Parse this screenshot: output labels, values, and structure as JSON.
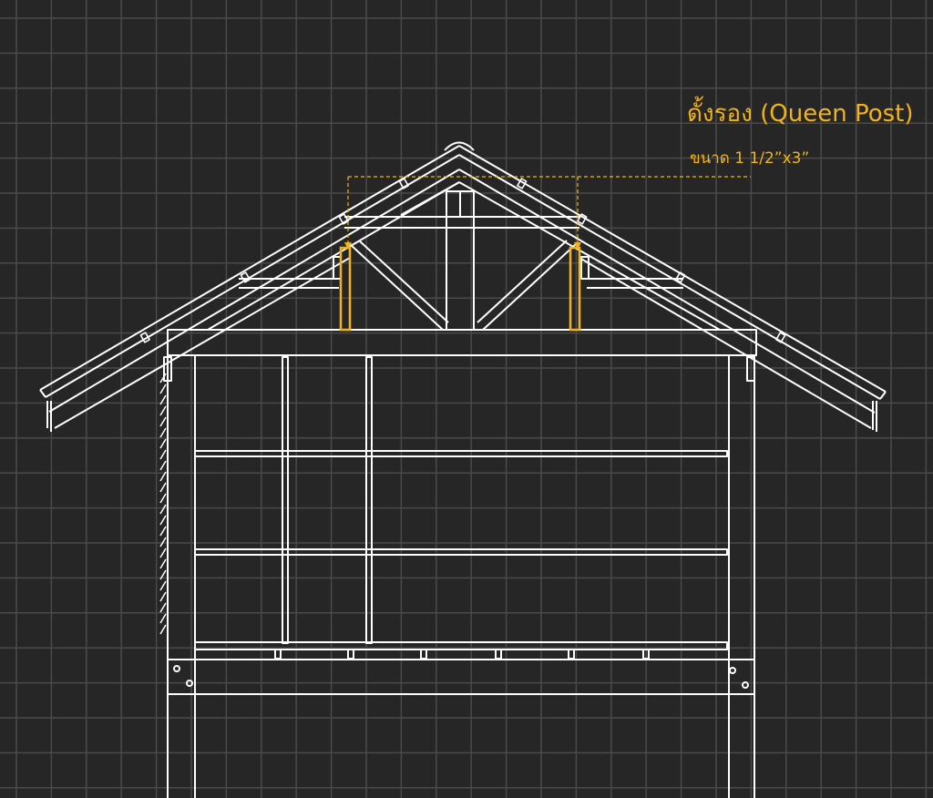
{
  "annotation": {
    "title": "ดั้งรอง (Queen Post)",
    "size_label": "ขนาด 1 1/2”x3”"
  },
  "colors": {
    "background": "#262626",
    "grid": "#4a4a4a",
    "linework": "#ffffff",
    "highlight": "#f2b21b"
  }
}
